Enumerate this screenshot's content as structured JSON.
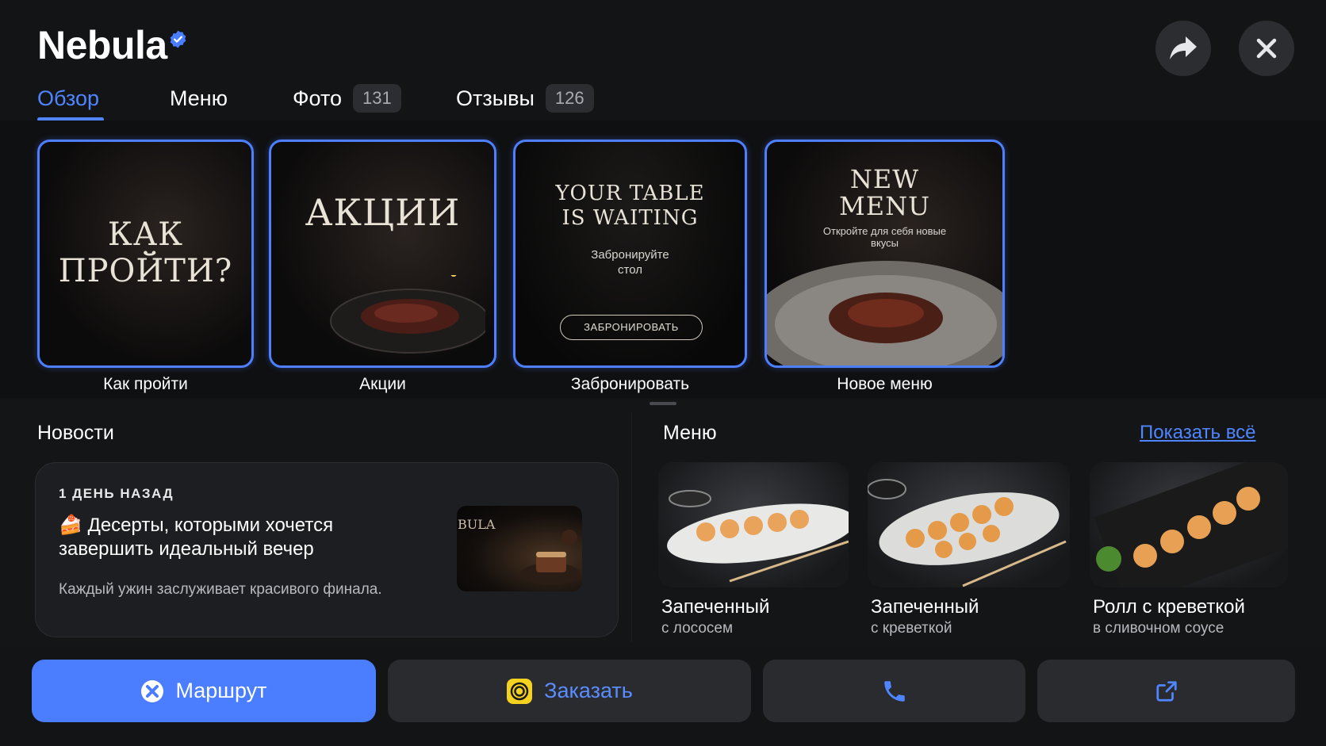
{
  "header": {
    "title": "Nebula",
    "verified_icon": "verified-badge-icon",
    "share_icon": "share-arrow-icon",
    "close_icon": "close-icon"
  },
  "tabs": [
    {
      "label": "Обзор",
      "active": true
    },
    {
      "label": "Меню"
    },
    {
      "label": "Фото",
      "count": "131"
    },
    {
      "label": "Отзывы",
      "count": "126"
    }
  ],
  "stories": [
    {
      "caption": "Как пройти",
      "big_text": "КАК ПРОЙТИ?"
    },
    {
      "caption": "Акции",
      "big_text": "АКЦИИ"
    },
    {
      "caption": "Забронировать",
      "big_text": "YOUR TABLE IS WAITING",
      "small_text": "Забронируйте стол",
      "button_text": "ЗАБРОНИРОВАТЬ"
    },
    {
      "caption": "Новое меню",
      "big_text": "NEW MENU",
      "small_text": "Откройте для себя новые вкусы"
    }
  ],
  "news": {
    "section_title": "Новости",
    "time": "1 ДЕНЬ НАЗАД",
    "emoji": "🍰",
    "headline": "Десерты, которыми хочется завершить идеальный вечер",
    "text": "Каждый ужин заслуживает красивого финала.",
    "thumb_text": "BULA"
  },
  "menu": {
    "section_title": "Меню",
    "show_all": "Показать всё",
    "items": [
      {
        "name": "Запеченный",
        "sub": "с лососем"
      },
      {
        "name": "Запеченный",
        "sub": "с креветкой"
      },
      {
        "name": "Ролл с креветкой",
        "sub": "в сливочном соусе"
      }
    ]
  },
  "actions": {
    "route": "Маршрут",
    "order": "Заказать",
    "call_icon": "phone-icon",
    "external_icon": "external-link-icon"
  },
  "colors": {
    "accent": "#4a7dff",
    "background": "#141517",
    "card": "#1d1e21"
  }
}
